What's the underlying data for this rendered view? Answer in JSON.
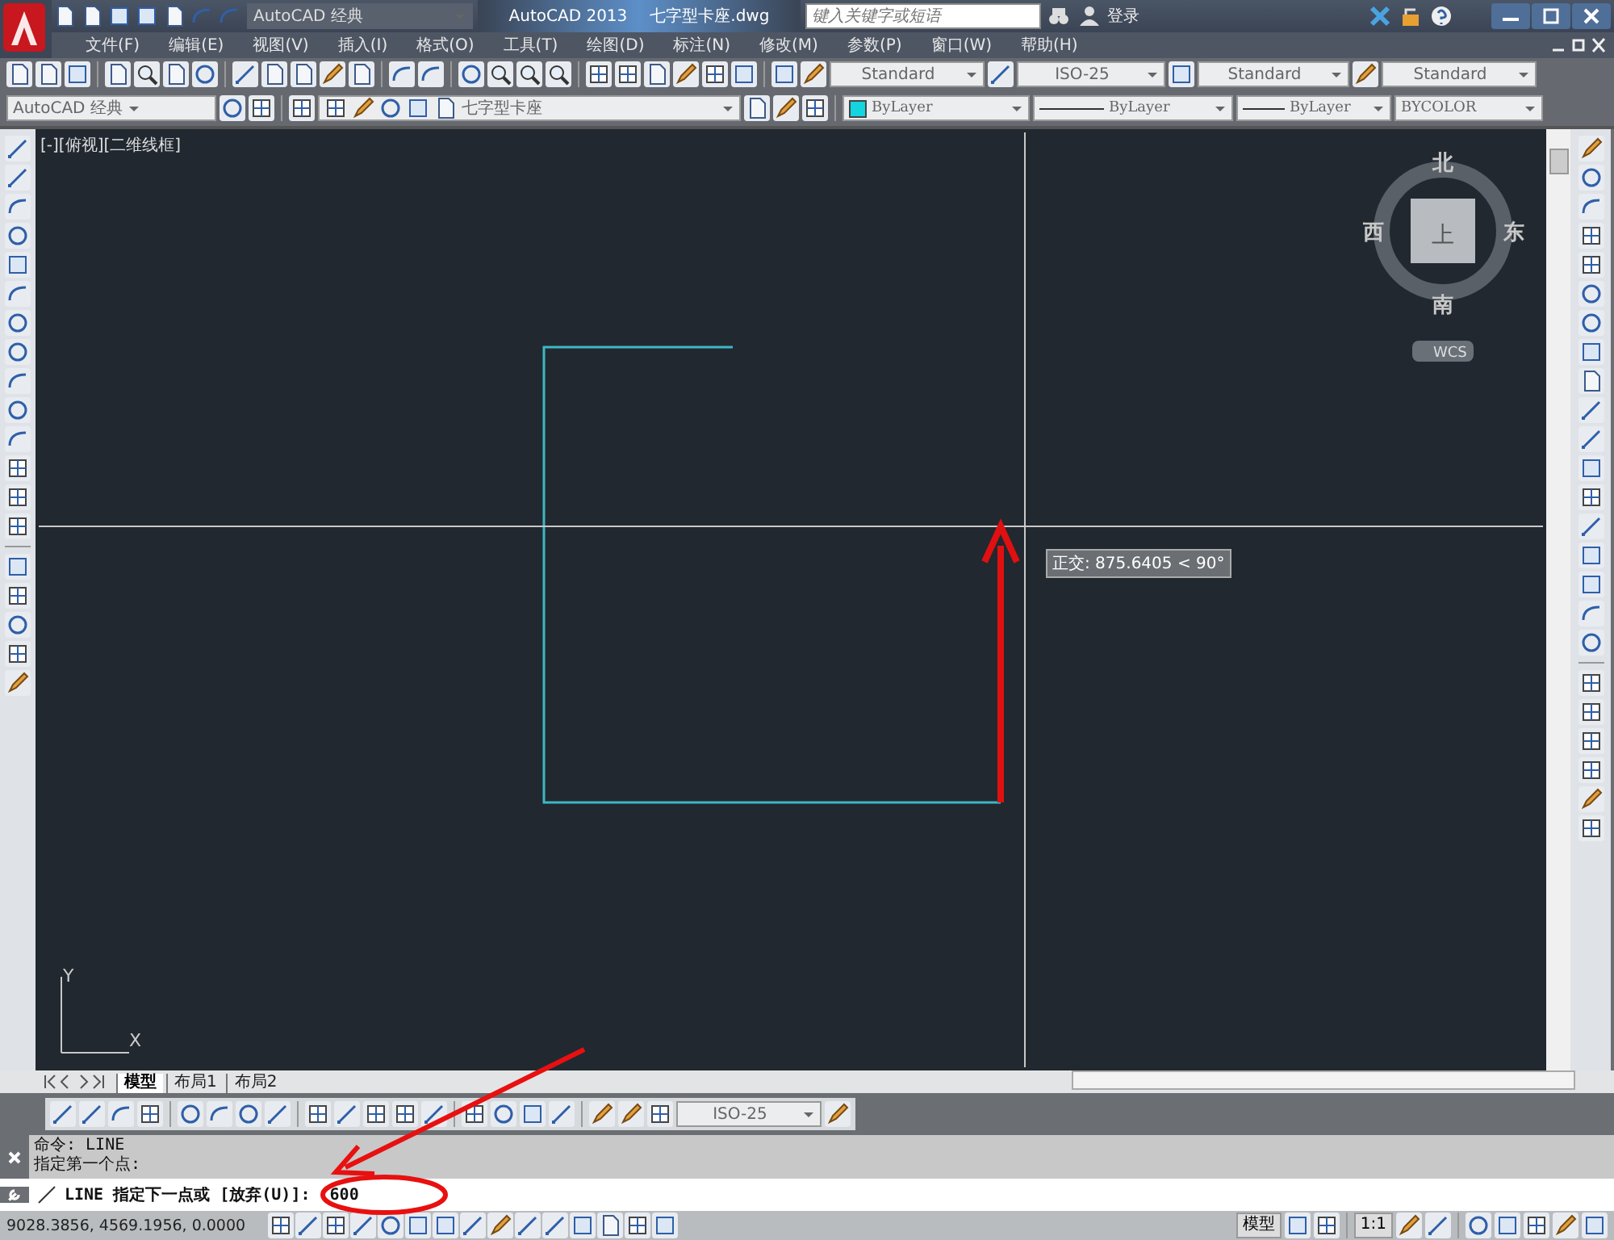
{
  "title_bar": {
    "workspace": "AutoCAD 经典",
    "app": "AutoCAD 2013",
    "file": "七字型卡座.dwg",
    "search": {
      "placeholder": "键入关键字或短语"
    },
    "sign_in": "登录"
  },
  "menu": [
    "文件(F)",
    "编辑(E)",
    "视图(V)",
    "插入(I)",
    "格式(O)",
    "工具(T)",
    "绘图(D)",
    "标注(N)",
    "修改(M)",
    "参数(P)",
    "窗口(W)",
    "帮助(H)"
  ],
  "styles_toolbar": [
    "Standard",
    "ISO-25",
    "Standard",
    "Standard"
  ],
  "layers_toolbar": {
    "workspace": "AutoCAD 经典",
    "layer": "七字型卡座",
    "object_colour": "ByLayer",
    "linetype": "ByLayer",
    "lineweight": "ByLayer",
    "plot_style": "BYCOLOR"
  },
  "viewport": {
    "label": "[-][俯视][二维线框]",
    "compass": {
      "north": "北",
      "south": "南",
      "west": "西",
      "east": "东",
      "top": "上"
    },
    "ucs": "WCS",
    "tooltip": "正交: 875.6405 < 90°",
    "axis_x": "X",
    "axis_y": "Y"
  },
  "layout_tabs": [
    {
      "label": "模型",
      "selected": true
    },
    {
      "label": "布局1",
      "selected": false
    },
    {
      "label": "布局2",
      "selected": false
    }
  ],
  "dimension_toolbar": {
    "style": "ISO-25"
  },
  "command_history": [
    "命令:  LINE",
    "指定第一个点:"
  ],
  "command_line": {
    "value": "LINE 指定下一点或 [放弃(U)]:  600"
  },
  "status_bar": {
    "coordinates": "9028.3856, 4569.1956, 0.0000",
    "space": "模型",
    "scale": "1:1"
  }
}
